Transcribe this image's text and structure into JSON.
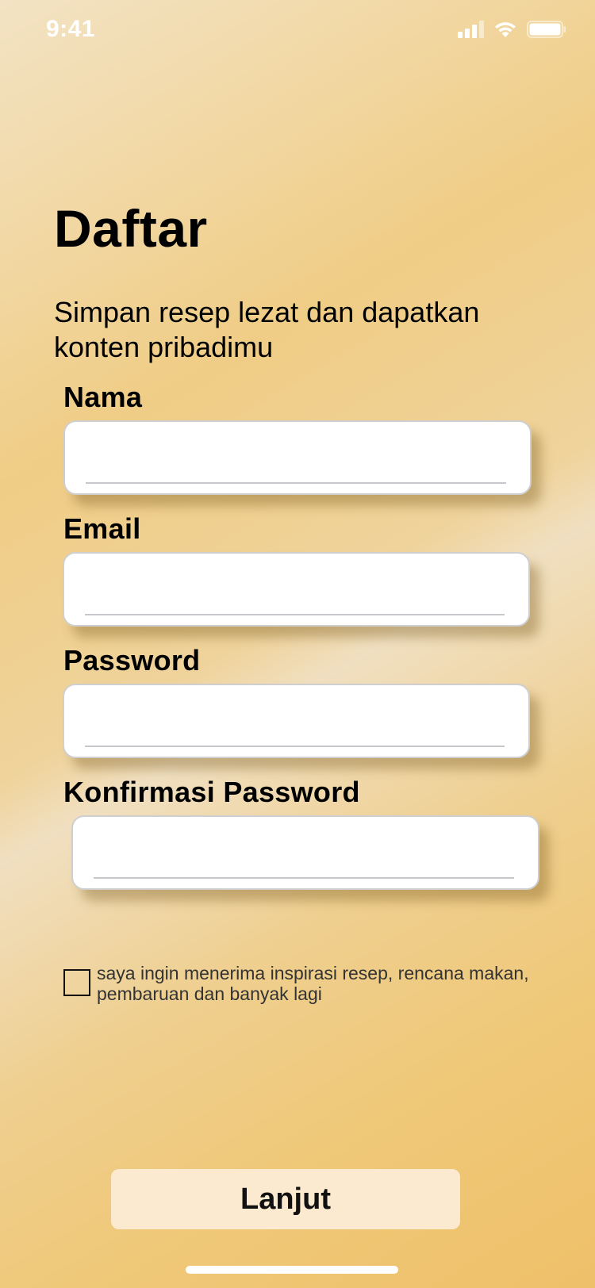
{
  "status_bar": {
    "time": "9:41",
    "icons": [
      "signal-icon",
      "wifi-icon",
      "battery-icon"
    ]
  },
  "header": {
    "title": "Daftar",
    "subtitle": "Simpan resep lezat dan dapatkan konten pribadimu"
  },
  "form": {
    "fields": [
      {
        "label": "Nama",
        "value": "",
        "placeholder": ""
      },
      {
        "label": "Email",
        "value": "",
        "placeholder": ""
      },
      {
        "label": "Password",
        "value": "",
        "placeholder": ""
      },
      {
        "label": "Konfirmasi Password",
        "value": "",
        "placeholder": ""
      }
    ],
    "newsletter": {
      "checked": false,
      "label": "saya ingin menerima inspirasi resep, rencana makan, pembaruan dan banyak lagi"
    }
  },
  "actions": {
    "next_label": "Lanjut"
  },
  "colors": {
    "button_background": "#fbeacf",
    "gradient_light": "#f3e3c4",
    "gradient_dark": "#efc06a",
    "input_border": "#cfcfcf"
  }
}
